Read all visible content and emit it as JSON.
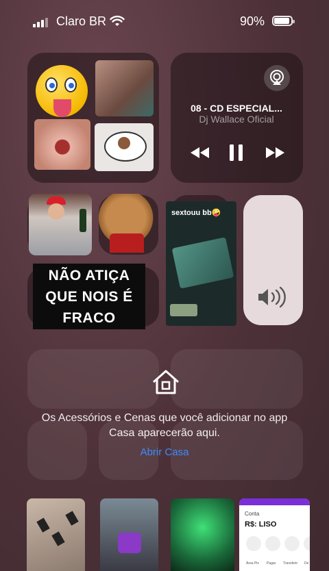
{
  "status": {
    "carrier": "Claro BR",
    "battery": "90%",
    "battery_level": 0.9
  },
  "music": {
    "title": "08 -  CD ESPECIAL...",
    "artist": "Dj Wallace Oficial",
    "icons": [
      "airplay-icon",
      "previous-icon",
      "pause-icon",
      "next-icon"
    ]
  },
  "stickers": {
    "meme_text": "NÃO ATIÇA\nQUE NOIS É\nFRACO",
    "video_caption": "sextouu bb🤪"
  },
  "home": {
    "message": "Os Acessórios e Cenas que você adicionar no app Casa aparecerão aqui.",
    "link": "Abrir Casa"
  },
  "bank_thumb": {
    "label": "Conta",
    "balance": "R$: LISO",
    "actions": [
      "Área Pix",
      "Pagar",
      "Transferir",
      "De"
    ]
  },
  "colors": {
    "background": "#5a3a42",
    "link": "#3a8dff"
  }
}
